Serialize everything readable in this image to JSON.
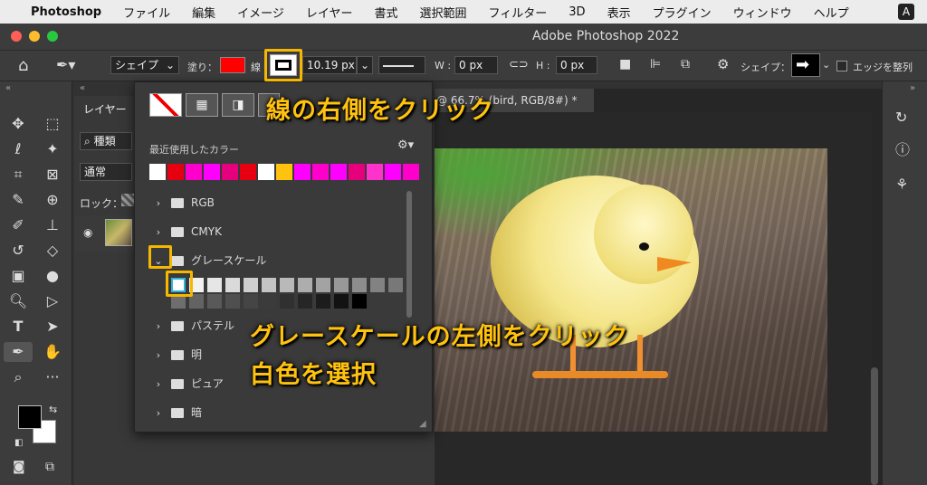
{
  "menubar": {
    "apple": "",
    "app": "Photoshop",
    "items": [
      "ファイル",
      "編集",
      "イメージ",
      "レイヤー",
      "書式",
      "選択範囲",
      "フィルター",
      "3D",
      "表示",
      "プラグイン",
      "ウィンドウ",
      "ヘルプ"
    ],
    "input_badge": "A"
  },
  "titlebar": {
    "title": "Adobe Photoshop 2022",
    "doc_tab": "@ 66.7% (bird, RGB/8#) *"
  },
  "options": {
    "mode": "シェイプ",
    "fill_label": "塗り：",
    "stroke_label": "線",
    "stroke_width": "10.19 px",
    "w_label": "W :",
    "w_value": "0 px",
    "h_label": "H :",
    "h_value": "0 px",
    "shape_label": "シェイプ：",
    "align_edges": "エッジを整列",
    "colors": {
      "fill": "#ff0000"
    }
  },
  "layers": {
    "tab": "レイヤー",
    "filter": "種類",
    "blend": "通常",
    "lock": "ロック："
  },
  "popup": {
    "recent_title": "最近使用したカラー",
    "recent_colors": [
      "#ffffff",
      "#e60012",
      "#ff00cc",
      "#ff00ff",
      "#e6007e",
      "#e60012",
      "#ffffff",
      "#ffc20e",
      "#ff00ff",
      "#ff00cc",
      "#ff00ff",
      "#e6007e",
      "#ff33cc",
      "#ff00ff",
      "#ff00cc"
    ],
    "folders": [
      {
        "name": "RGB"
      },
      {
        "name": "CMYK"
      },
      {
        "name": "グレースケール"
      },
      {
        "name": "パステル"
      },
      {
        "name": "明"
      },
      {
        "name": "ピュア"
      },
      {
        "name": "暗"
      }
    ],
    "gray_row1": [
      "#ffffff",
      "#f2f2f2",
      "#e6e6e6",
      "#dadada",
      "#cfcfcf",
      "#c4c4c4",
      "#b9b9b9",
      "#adadad",
      "#a3a3a3",
      "#989898",
      "#8d8d8d",
      "#828282",
      "#787878"
    ],
    "gray_row2": [
      "#6e6e6e",
      "#636363",
      "#595959",
      "#4f4f4f",
      "#454545",
      "#3b3b3b",
      "#303030",
      "#262626",
      "#1c1c1c",
      "#121212",
      "#000000"
    ]
  },
  "annotations": {
    "stroke_right": "線の右側をクリック",
    "gray_left": "グレースケールの左側をクリック",
    "select_white": "白色を選択"
  }
}
